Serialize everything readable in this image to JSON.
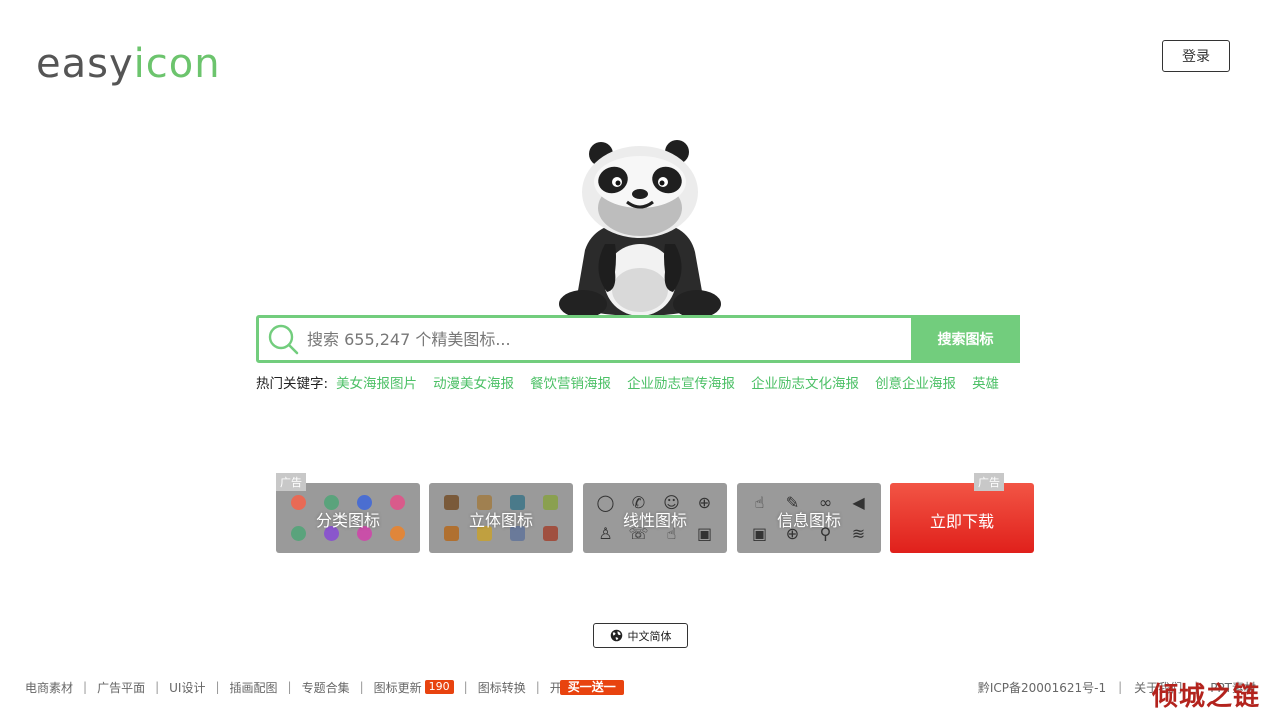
{
  "logo": {
    "part1": "easy",
    "part2": "icon"
  },
  "header": {
    "login_label": "登录"
  },
  "search": {
    "placeholder": "搜索 655,247 个精美图标...",
    "button_label": "搜索图标"
  },
  "hot_keywords": {
    "label": "热门关键字:",
    "items": [
      "美女海报图片",
      "动漫美女海报",
      "餐饮营销海报",
      "企业励志宣传海报",
      "企业励志文化海报",
      "创意企业海报",
      "英雄"
    ]
  },
  "categories": [
    {
      "label": "分类图标",
      "ad": "广告"
    },
    {
      "label": "立体图标"
    },
    {
      "label": "线性图标"
    },
    {
      "label": "信息图标"
    },
    {
      "label": "立即下载",
      "ad": "广告"
    }
  ],
  "language": {
    "label": "中文简体"
  },
  "footer": {
    "links": [
      "电商素材",
      "广告平面",
      "UI设计",
      "插画配图",
      "专题合集",
      "图标更新",
      "图标转换",
      "开"
    ],
    "update_badge": "190",
    "promo_badge": "买一送一",
    "icp": "黔ICP备20001621号-1",
    "right_links": [
      "关于我们",
      "PPT素材"
    ]
  },
  "watermark": "倾城之链",
  "colors": {
    "accent": "#72cd7d",
    "link_green": "#4cc066",
    "badge": "#e8430f",
    "download": "#e0201b"
  }
}
